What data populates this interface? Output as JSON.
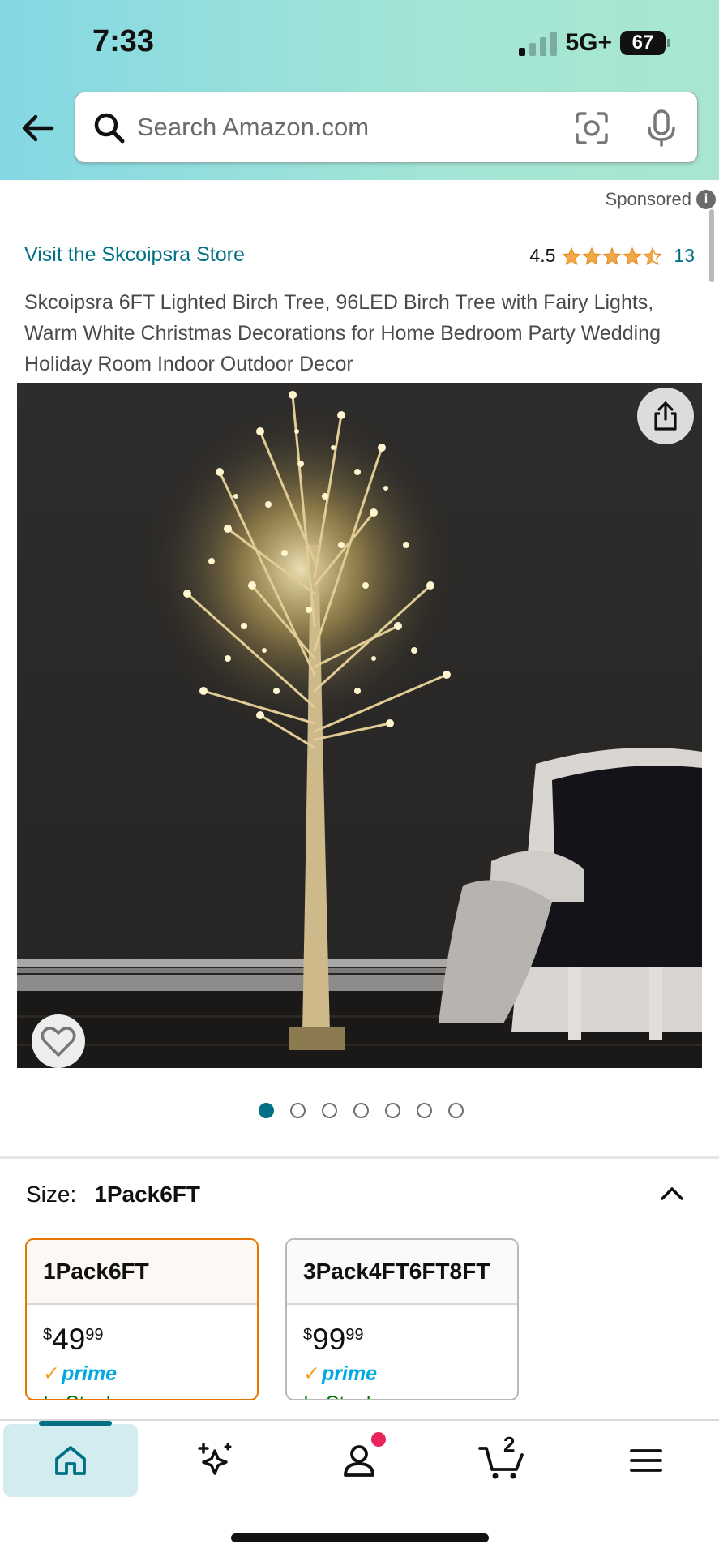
{
  "status_bar": {
    "time": "7:33",
    "network": "5G+",
    "battery": "67"
  },
  "search": {
    "placeholder": "Search Amazon.com"
  },
  "sponsored_label": "Sponsored",
  "store_link": "Visit the Skcoipsra Store",
  "rating": {
    "value": "4.5",
    "count": "13",
    "stars": 4.5
  },
  "product_title": "Skcoipsra 6FT Lighted Birch Tree, 96LED Birch Tree with Fairy Lights, Warm White Christmas Decorations for Home Bedroom Party Wedding Holiday Room Indoor Outdoor Decor",
  "image_carousel": {
    "count": 7,
    "active_index": 0
  },
  "size": {
    "label": "Size:",
    "selected": "1Pack6FT",
    "options": [
      {
        "name": "1Pack6FT",
        "currency": "$",
        "price_whole": "49",
        "price_fraction": "99",
        "prime": "prime",
        "stock": "In Stock"
      },
      {
        "name": "3Pack4FT6FT8FT",
        "currency": "$",
        "price_whole": "99",
        "price_fraction": "99",
        "prime": "prime",
        "stock": "In Stock"
      }
    ]
  },
  "bottom_nav": {
    "items": [
      "home-icon",
      "sparkle-icon",
      "account-icon",
      "cart-icon",
      "menu-icon"
    ],
    "cart_count": "2"
  },
  "colors": {
    "header": "#a3e5d6",
    "link": "#007185",
    "star": "#f3a847",
    "selected_border": "#e77600",
    "in_stock": "#007600",
    "prime": "#00a8e1"
  }
}
